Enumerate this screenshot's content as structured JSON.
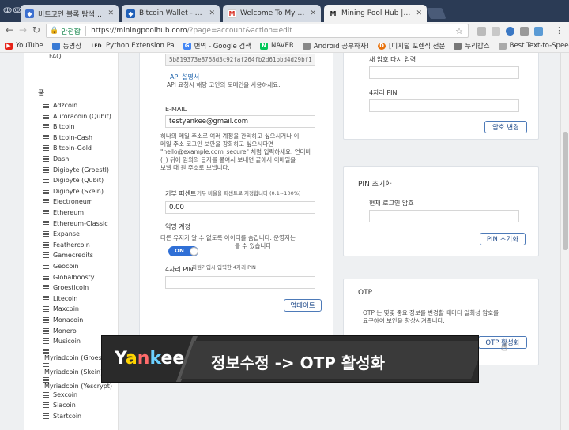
{
  "window_controls": "ↂↂ",
  "tabs": [
    {
      "title": "비트코인 블록 탐색기 - ",
      "color": "#3b6fd0",
      "active": false
    },
    {
      "title": "Bitcoin Wallet - Blockch",
      "color": "#1e5fb8",
      "active": false
    },
    {
      "title": "Welcome To My Wallet",
      "color": "#d93025",
      "icon": "M",
      "active": false
    },
    {
      "title": "Mining Pool Hub | Acco",
      "color": "#222",
      "icon": "M",
      "active": true
    }
  ],
  "address": {
    "secure_label": "안전함",
    "host": "https://miningpoolhub.com",
    "path": "/?page=account&action=edit"
  },
  "bookmarks": [
    {
      "label": "YouTube",
      "color": "#e62117",
      "icon": "▶"
    },
    {
      "label": "동영상",
      "color": "#3a7bd5",
      "icon": ""
    },
    {
      "label": "Python Extension Pa",
      "color": "#555",
      "icon": "LFD"
    },
    {
      "label": "번역 - Google 검색",
      "color": "#4285f4",
      "icon": "G"
    },
    {
      "label": "NAVER",
      "color": "#03c75a",
      "icon": "N"
    },
    {
      "label": "Android 공부하자!",
      "color": "#666",
      "icon": ""
    },
    {
      "label": "[디지털 포렌식 전문",
      "color": "#e8710a",
      "icon": "D"
    },
    {
      "label": "누리캅스",
      "color": "#555",
      "icon": ""
    },
    {
      "label": "Best Text-to-Speech",
      "color": "#888",
      "icon": ""
    }
  ],
  "sidebar": {
    "faq": "FAQ",
    "header": "풀",
    "coins": [
      "Adzcoin",
      "Auroracoin (Qubit)",
      "Bitcoin",
      "Bitcoin-Cash",
      "Bitcoin-Gold",
      "Dash",
      "Digibyte (Groestl)",
      "Digibyte (Qubit)",
      "Digibyte (Skein)",
      "Electroneum",
      "Ethereum",
      "Ethereum-Classic",
      "Expanse",
      "Feathercoin",
      "Gamecredits",
      "Geocoin",
      "Globalboosty",
      "Groestlcoin",
      "Litecoin",
      "Maxcoin",
      "Monacoin",
      "Monero",
      "Musicoin"
    ],
    "coins_indented": [
      "Myriadcoin (Groestl)",
      "Myriadcoin (Skein)",
      "Myriadcoin (Yescrypt)"
    ],
    "coins_after": [
      "Sexcoin",
      "Siacoin",
      "Startcoin"
    ]
  },
  "account": {
    "api_key": "5b819373e8768d3c92faf264fb2d61bbd4d29bf1",
    "api_link": "API 설명서",
    "api_note": "API 요청시 해당 코인의 도메인을 사용하세요.",
    "email_label": "E-MAIL",
    "email_value": "testyankee@gmail.com",
    "email_help_1": "하나의 메일 주소로 여러 계정을 관리하고 싶으시거나 이",
    "email_help_2": "메일 주소 로그인 보안을 강화하고 싶으시다면",
    "email_help_3": "\"hello@example.com_secure\" 처럼 입력하세요. 언더바",
    "email_help_4": "(_) 뒤에 임의의 글자를 붙여서 보내면 끝에서 이메일을",
    "email_help_5": "보낼 때 원 주소로 보냅니다.",
    "donation_label": "기부 퍼센트",
    "donation_hint": "기부 비율을 퍼센트로 지정합니다 (0.1~100%)",
    "donation_value": "0.00",
    "anon_label": "익명 계정",
    "anon_help_1": "다른 유저가 알 수 없도록 아이디를 숨깁니다. 운영자는",
    "anon_help_2": "볼 수 있습니다",
    "toggle_label": "ON",
    "pin_label": "4자리 PIN",
    "pin_hint": "회원가입시 입력한 4자리 PIN",
    "update_button": "업데이트"
  },
  "password": {
    "confirm_label": "새 암호 다시 입력",
    "pin_label": "4자리 PIN",
    "change_button": "암호 변경"
  },
  "pin_reset": {
    "title": "PIN 초기화",
    "current_pw_label": "현재 로그인 암호",
    "reset_button": "PIN 초기화"
  },
  "otp": {
    "title": "OTP",
    "desc_1": "OTP 는 몇몇 중요 정보를 변경할 때마다 일회성 암호를",
    "desc_2": "요구하여 보안을 향상시켜줍니다.",
    "activate_button": "OTP 활성화"
  },
  "caption": {
    "brand_y": "Y",
    "brand_a": "a",
    "brand_n": "n",
    "brand_k": "k",
    "brand_ee": "ee",
    "text": "정보수정 -> OTP 활성화"
  }
}
